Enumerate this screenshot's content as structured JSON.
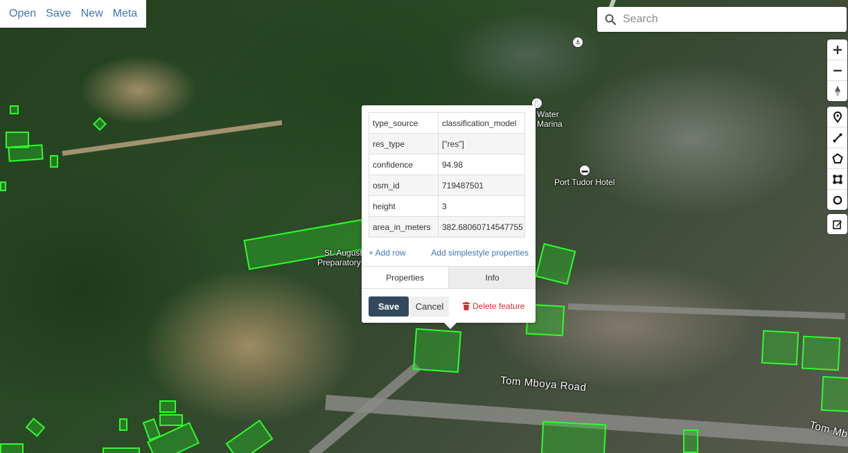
{
  "menu": {
    "open": "Open",
    "save": "Save",
    "new": "New",
    "meta": "Meta"
  },
  "search": {
    "placeholder": "Search"
  },
  "map": {
    "labels": {
      "water_marina_1": "Water",
      "water_marina_2": "Marina",
      "hotel": "Port Tudor Hotel",
      "school_1": "St. August",
      "school_2": "Preparatory",
      "road_1": "Tom Mboya Road",
      "road_2": "Tom Mb"
    }
  },
  "popup": {
    "properties": [
      {
        "key": "type_source",
        "value": "classification_model"
      },
      {
        "key": "res_type",
        "value": "[\"res\"]"
      },
      {
        "key": "confidence",
        "value": "94.98"
      },
      {
        "key": "osm_id",
        "value": "719487501"
      },
      {
        "key": "height",
        "value": "3"
      },
      {
        "key": "area_in_meters",
        "value": "382.68060714547755"
      }
    ],
    "add_row": "+ Add row",
    "add_simplestyle": "Add simplestyle properties",
    "tabs": {
      "properties": "Properties",
      "info": "Info"
    },
    "save": "Save",
    "cancel": "Cancel",
    "delete": "Delete feature"
  },
  "controls": {
    "zoom": [
      "plus-icon",
      "minus-icon",
      "compass-icon"
    ],
    "draw": [
      "marker-icon",
      "line-icon",
      "polygon-icon",
      "rectangle-icon",
      "circle-icon"
    ],
    "edit": [
      "edit-icon"
    ]
  },
  "colors": {
    "accent": "#3b78b5",
    "save_button": "#34495e",
    "delete": "#d32f2f",
    "feature_outline": "#2aff2a"
  }
}
